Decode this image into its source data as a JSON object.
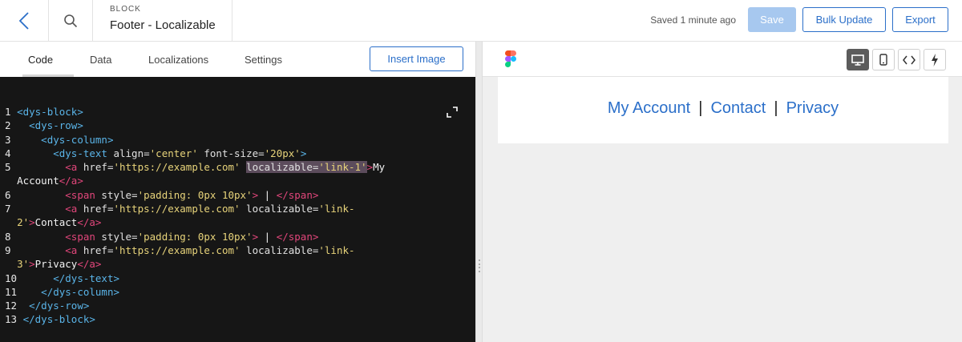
{
  "header": {
    "kicker": "BLOCK",
    "title": "Footer - Localizable",
    "saved_status": "Saved 1 minute ago",
    "save_label": "Save",
    "bulk_update_label": "Bulk Update",
    "export_label": "Export"
  },
  "tabs": [
    {
      "label": "Code",
      "active": true
    },
    {
      "label": "Data",
      "active": false
    },
    {
      "label": "Localizations",
      "active": false
    },
    {
      "label": "Settings",
      "active": false
    }
  ],
  "insert_image_label": "Insert Image",
  "code_lines": {
    "n1": "1",
    "n2": "2",
    "n3": "3",
    "n4": "4",
    "n5": "5",
    "n6": "6",
    "n7": "7",
    "n8": "8",
    "n9": "9",
    "n10": "10",
    "n11": "11",
    "n12": "12",
    "n13": "13",
    "l1_tag": "<dys-block>",
    "l2_tag": "<dys-row>",
    "l3_tag": "<dys-column>",
    "l4_tag": "<dys-text",
    "l4_a1": " align=",
    "l4_v1": "'center'",
    "l4_a2": " font-size=",
    "l4_v2": "'20px'",
    "l4_end": ">",
    "l5_tag": "<a",
    "l5_a1": " href=",
    "l5_v1": "'https://example.com'",
    "l5_a2": "localizable=",
    "l5_v2": "'link-1'",
    "l5_end": ">",
    "l5_text": "My",
    "l5b_text": "Account",
    "l5b_close": "</a>",
    "l6_tag": "<span",
    "l6_a1": " style=",
    "l6_v1": "'padding: 0px 10px'",
    "l6_end": ">",
    "l6_text": " | ",
    "l6_close": "</span>",
    "l7_tag": "<a",
    "l7_a1": " href=",
    "l7_v1": "'https://example.com'",
    "l7_a2": " localizable=",
    "l7_v2": "'link-",
    "l7b_v2": "2'",
    "l7b_end": ">",
    "l7b_text": "Contact",
    "l7b_close": "</a>",
    "l8_tag": "<span",
    "l8_a1": " style=",
    "l8_v1": "'padding: 0px 10px'",
    "l8_end": ">",
    "l8_text": " | ",
    "l8_close": "</span>",
    "l9_tag": "<a",
    "l9_a1": " href=",
    "l9_v1": "'https://example.com'",
    "l9_a2": " localizable=",
    "l9_v2": "'link-",
    "l9b_v2": "3'",
    "l9b_end": ">",
    "l9b_text": "Privacy",
    "l9b_close": "</a>",
    "l10_close": "</dys-text>",
    "l11_close": "</dys-column>",
    "l12_close": "</dys-row>",
    "l13_close": "</dys-block>"
  },
  "preview": {
    "links": [
      "My Account",
      "Contact",
      "Privacy"
    ],
    "separator": "|"
  },
  "colors": {
    "accent": "#2b6fc9",
    "save_disabled": "#a7c8ef",
    "editor_bg": "#161616",
    "tag": "#5ab4e8",
    "string": "#e7d37a",
    "close_tag": "#e2467b"
  },
  "icons": {
    "back": "chevron-left-icon",
    "search": "search-icon",
    "expand": "expand-icon",
    "figma": "figma-icon",
    "desktop": "desktop-icon",
    "mobile": "mobile-icon",
    "code": "code-icon",
    "flash": "lightning-icon"
  }
}
